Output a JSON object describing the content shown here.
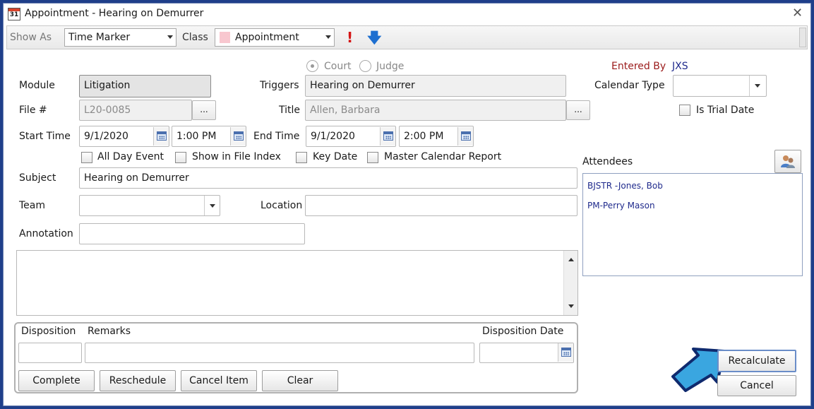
{
  "window": {
    "icon_text": "31",
    "title": "Appointment - Hearing on Demurrer"
  },
  "toolbar": {
    "show_as_label": "Show As",
    "show_as_value": "Time Marker",
    "class_label": "Class",
    "class_value": "Appointment",
    "class_color": "#f8c7cf",
    "priority_high_icon": "exclamation-red",
    "priority_low_icon": "down-arrow-blue"
  },
  "form": {
    "court_label": "Court",
    "judge_label": "Judge",
    "entered_by_label": "Entered By",
    "entered_by_value": "JXS",
    "module_label": "Module",
    "module_value": "Litigation",
    "triggers_label": "Triggers",
    "triggers_value": "Hearing on Demurrer",
    "calendar_type_label": "Calendar Type",
    "calendar_type_value": "",
    "file_label": "File #",
    "file_value": "L20-0085",
    "title_label": "Title",
    "title_value": "Allen, Barbara",
    "dots": "...",
    "is_trial_date_label": "Is Trial Date",
    "start_time_label": "Start Time",
    "start_date": "9/1/2020",
    "start_time": "1:00 PM",
    "end_time_label": "End Time",
    "end_date": "9/1/2020",
    "end_time": "2:00 PM",
    "all_day_label": "All Day Event",
    "show_in_file_index_label": "Show in File Index",
    "key_date_label": "Key Date",
    "master_calendar_label": "Master Calendar Report",
    "subject_label": "Subject",
    "subject_value": "Hearing on Demurrer",
    "team_label": "Team",
    "team_value": "",
    "location_label": "Location",
    "location_value": "",
    "annotation_label": "Annotation",
    "annotation_value": "",
    "notes_value": ""
  },
  "attendees": {
    "label": "Attendees",
    "items": [
      "BJSTR  -Jones, Bob",
      "PM-Perry Mason"
    ]
  },
  "disposition": {
    "disposition_label": "Disposition",
    "remarks_label": "Remarks",
    "date_label": "Disposition Date",
    "disposition_value": "",
    "remarks_value": "",
    "date_value": "",
    "complete_label": "Complete",
    "reschedule_label": "Reschedule",
    "cancel_item_label": "Cancel Item",
    "clear_label": "Clear"
  },
  "actions": {
    "recalculate_label": "Recalculate",
    "cancel_label": "Cancel"
  },
  "colors": {
    "frame": "#1f3f8a",
    "entered_by": "#9b1b1b",
    "attendee_text": "#1f2a8c",
    "callout_arrow": "#3aa6e0"
  }
}
